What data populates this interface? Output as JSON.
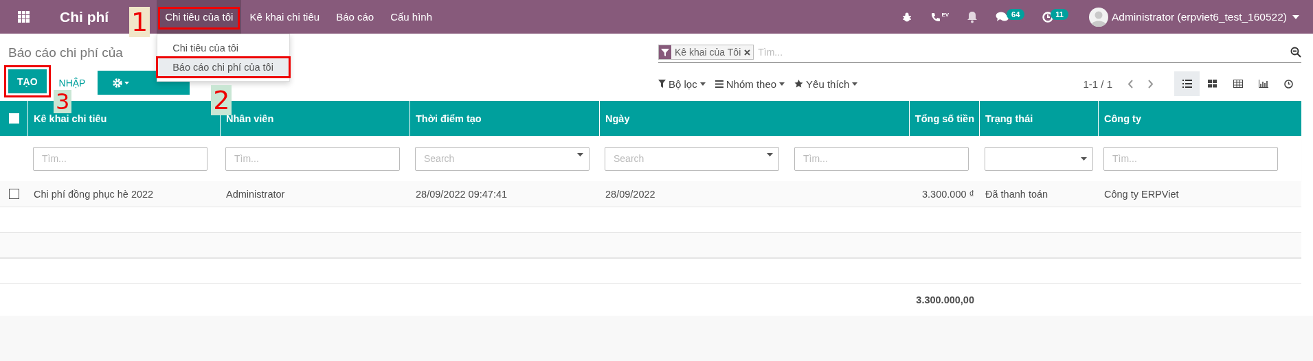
{
  "navbar": {
    "app_title": "Chi phí",
    "menus": [
      {
        "label": "Chi tiêu của tôi",
        "selected": true,
        "highlighted": true,
        "annotation": "1"
      },
      {
        "label": "Kê khai chi tiêu",
        "selected": false,
        "highlighted": false
      },
      {
        "label": "Báo cáo",
        "selected": false,
        "highlighted": false
      },
      {
        "label": "Cấu hình",
        "selected": false,
        "highlighted": false
      }
    ],
    "phone_label": "EV",
    "chat_count": "64",
    "activity_count": "11",
    "user": "Administrator (erpviet6_test_160522)"
  },
  "dropdown": {
    "items": [
      {
        "label": "Chi tiêu của tôi",
        "selected": false,
        "highlighted": false
      },
      {
        "label": "Báo cáo chi phí của tôi",
        "selected": true,
        "highlighted": true,
        "annotation": "2"
      }
    ]
  },
  "breadcrumb": "Báo cáo chi phí của",
  "create_button": {
    "label": "TẠO",
    "highlighted": true,
    "annotation": "3"
  },
  "import_button": "NHẬP",
  "search": {
    "facet": "Kê khai của Tôi",
    "placeholder": "Tìm..."
  },
  "filters": [
    "Bộ lọc",
    "Nhóm theo",
    "Yêu thích"
  ],
  "pager": "1-1 / 1",
  "views": [
    {
      "kind": "list",
      "selected": true
    },
    {
      "kind": "kanban",
      "selected": false
    },
    {
      "kind": "pivot",
      "selected": false
    },
    {
      "kind": "graph",
      "selected": false
    },
    {
      "kind": "activity",
      "selected": false
    }
  ],
  "table": {
    "select_all_checked": false,
    "columns": [
      {
        "label": "Kê khai chi tiêu",
        "kind": "text"
      },
      {
        "label": "Nhân viên",
        "kind": "text"
      },
      {
        "label": "Thời điểm tạo",
        "kind": "text"
      },
      {
        "label": "Ngày",
        "kind": "text"
      },
      {
        "label": "Tổng số tiền",
        "kind": "amount"
      },
      {
        "label": "Trạng thái",
        "kind": "text"
      },
      {
        "label": "Công ty",
        "kind": "text"
      }
    ],
    "filters": [
      {
        "kind": "text",
        "placeholder": "Tìm..."
      },
      {
        "kind": "text",
        "placeholder": "Tìm..."
      },
      {
        "kind": "select",
        "placeholder": "Search"
      },
      {
        "kind": "select",
        "placeholder": "Search"
      },
      {
        "kind": "text",
        "placeholder": "Tìm..."
      },
      {
        "kind": "select"
      },
      {
        "kind": "text",
        "placeholder": "Tìm..."
      }
    ],
    "rows": [
      {
        "checked": false,
        "cells": [
          "Chi phí đồng phục hè 2022",
          "Administrator",
          "28/09/2022 09:47:41",
          "28/09/2022",
          "3.300.000 ₫",
          "Đã thanh toán",
          "Công ty ERPViet"
        ]
      }
    ],
    "total": "3.300.000,00"
  }
}
